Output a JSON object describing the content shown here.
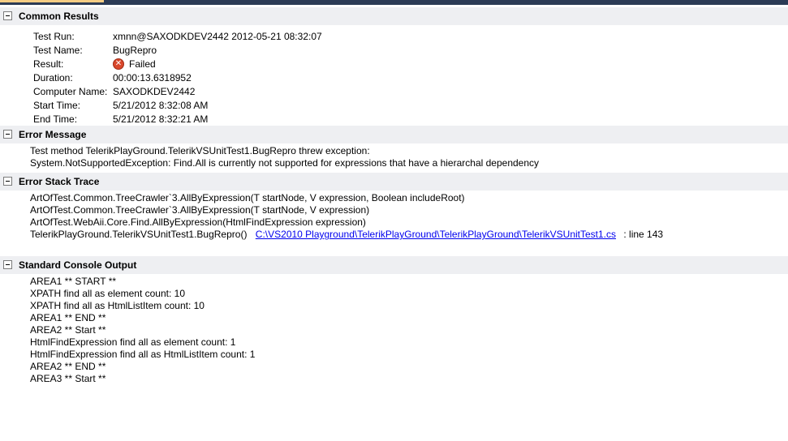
{
  "sections": {
    "common_results": "Common Results",
    "error_message": "Error Message",
    "error_stack_trace": "Error Stack Trace",
    "standard_console_output": "Standard Console Output"
  },
  "common": {
    "test_run_label": "Test Run:",
    "test_run_value": "xmnn@SAXODKDEV2442 2012-05-21 08:32:07",
    "test_name_label": "Test Name:",
    "test_name_value": "BugRepro",
    "result_label": "Result:",
    "result_value": "Failed",
    "result_icon": "error-icon",
    "duration_label": "Duration:",
    "duration_value": "00:00:13.6318952",
    "computer_name_label": "Computer Name:",
    "computer_name_value": "SAXODKDEV2442",
    "start_time_label": "Start Time:",
    "start_time_value": "5/21/2012 8:32:08 AM",
    "end_time_label": "End Time:",
    "end_time_value": "5/21/2012 8:32:21 AM"
  },
  "error_message": [
    "Test method TelerikPlayGround.TelerikVSUnitTest1.BugRepro threw exception:",
    "System.NotSupportedException: Find.All is currently not supported for expressions that have a hierarchal dependency"
  ],
  "stack_trace": {
    "lines": [
      "ArtOfTest.Common.TreeCrawler`3.AllByExpression(T startNode, V expression, Boolean includeRoot)",
      "ArtOfTest.Common.TreeCrawler`3.AllByExpression(T startNode, V expression)",
      "ArtOfTest.WebAii.Core.Find.AllByExpression(HtmlFindExpression expression)"
    ],
    "last_line": {
      "method": "TelerikPlayGround.TelerikVSUnitTest1.BugRepro()",
      "link": "C:\\VS2010 Playground\\TelerikPlayGround\\TelerikPlayGround\\TelerikVSUnitTest1.cs",
      "suffix": ": line 143"
    }
  },
  "console_output": [
    "AREA1 ** START **",
    "XPATH find all as element count: 10",
    "XPATH find all as HtmlListItem count: 10",
    "AREA1 ** END **",
    "AREA2 ** Start **",
    "HtmlFindExpression find all as element count: 1",
    "HtmlFindExpression find all as HtmlListItem count: 1",
    "AREA2 ** END **",
    "AREA3 ** Start **"
  ],
  "colors": {
    "header_bg": "#eeeff2",
    "link": "#0000ee",
    "failed_icon": "#d9472b"
  }
}
